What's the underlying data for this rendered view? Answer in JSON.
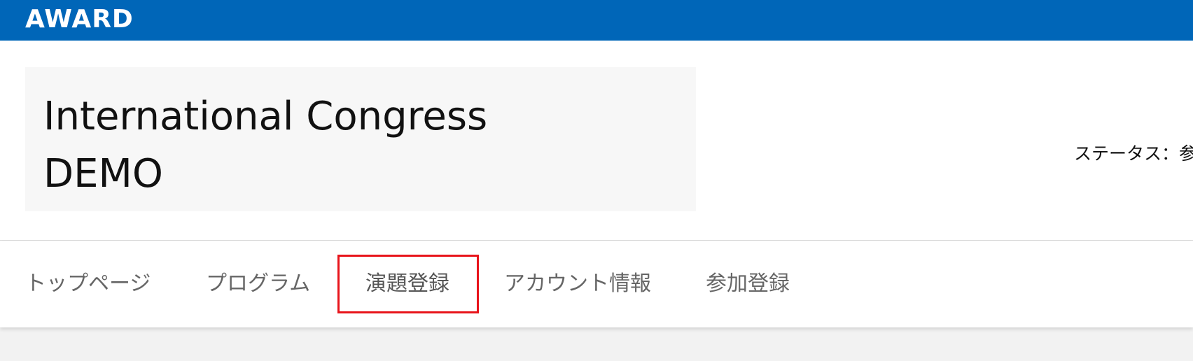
{
  "topbar": {
    "logo_text": "AWARD",
    "background": "#0066b8"
  },
  "header": {
    "banner_title": "International Congress\nDEMO",
    "status_text": "ステータス：参"
  },
  "nav": {
    "items": [
      {
        "label": "トップページ"
      },
      {
        "label": "プログラム"
      },
      {
        "label": "演題登録",
        "highlighted": true
      },
      {
        "label": "アカウント情報"
      },
      {
        "label": "参加登録"
      }
    ],
    "highlight_color": "#e8141b"
  }
}
